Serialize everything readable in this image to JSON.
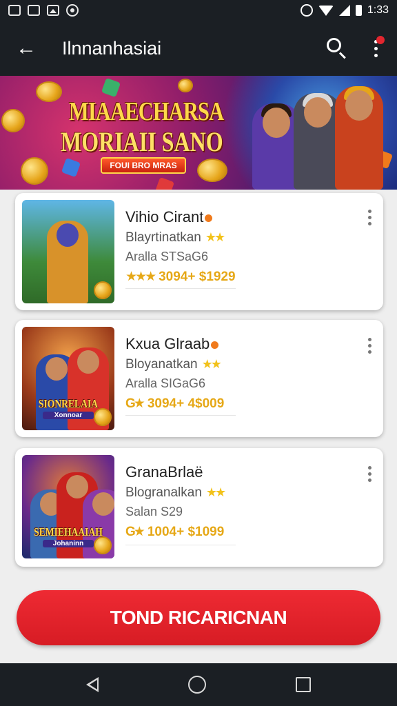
{
  "status_bar": {
    "time": "1:33",
    "icons": [
      "notification-p-icon",
      "notification-s-icon",
      "gallery-icon",
      "record-icon",
      "alarm-icon",
      "wifi-icon",
      "signal-icon",
      "battery-icon"
    ]
  },
  "app_bar": {
    "title": "Ilnnanhasiai",
    "back_icon": "arrow-left-icon",
    "search_icon": "search-icon",
    "more_icon": "more-vertical-icon"
  },
  "banner": {
    "title_line1": "MIAAECHARSA",
    "title_line2": "MORIAII SANO",
    "tag": "FOUI BRO MRAS"
  },
  "games": [
    {
      "name": "Vihio Cirant",
      "category": "Blayrtinatkan",
      "category_stars": "★★",
      "meta": "Aralla STSaG6",
      "rating_stars": "★★★",
      "rating_text": "3094+ $1929",
      "thumb_title": "",
      "thumb_sub": ""
    },
    {
      "name": "Kxua Glraab",
      "category": "Bloyanatkan",
      "category_stars": "★★",
      "meta": "Aralla SIGaG6",
      "rating_stars": "G★",
      "rating_text": "3094+ 4$009",
      "thumb_title": "SIONRELAIA",
      "thumb_sub": "Xonnoar"
    },
    {
      "name": "GranaBrlaë",
      "category": "Blogranalkan",
      "category_stars": "★★",
      "meta": "Salan S29",
      "rating_stars": "G★",
      "rating_text": "1004+ $1099",
      "thumb_title": "SEMIEHAAIAH",
      "thumb_sub": "Johaninn"
    }
  ],
  "cta": {
    "label": "TOND RICARICNAN"
  },
  "colors": {
    "accent": "#e3262f",
    "bar": "#1b1f24",
    "star": "#f2c21b"
  }
}
